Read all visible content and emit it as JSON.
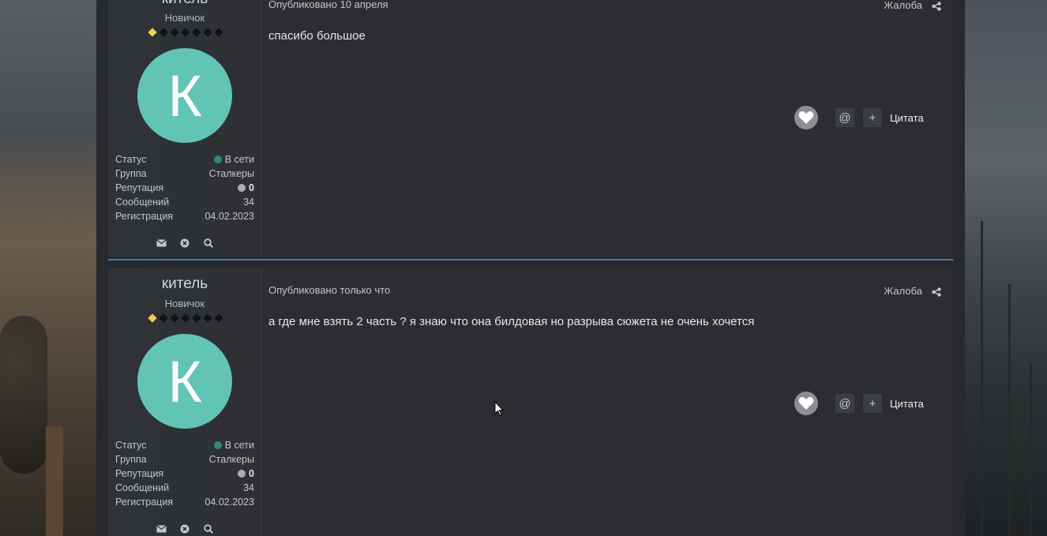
{
  "posts": [
    {
      "author": {
        "name": "китель",
        "rank": "Новичок",
        "avatar_letter": "К",
        "avatar_color": "#62c4b5",
        "rank_pips_filled": 1,
        "rank_pips_total": 7,
        "info": [
          {
            "label": "Статус",
            "value": "В сети"
          },
          {
            "label": "Группа",
            "value": "Сталкеры"
          },
          {
            "label": "Репутация",
            "value": "0"
          },
          {
            "label": "Сообщений",
            "value": "34"
          },
          {
            "label": "Регистрация",
            "value": "04.02.2023"
          }
        ],
        "actions": [
          "envelope-icon",
          "ignore-icon",
          "search-icon"
        ]
      },
      "meta": "Опубликовано 10 апреля",
      "report": "Жалоба",
      "content": "спасибо большое",
      "quote_label": "Цитата",
      "mention_label": "@",
      "multiquote_label": "+"
    },
    {
      "author": {
        "name": "китель",
        "rank": "Новичок",
        "avatar_letter": "К",
        "avatar_color": "#62c4b5",
        "rank_pips_filled": 1,
        "rank_pips_total": 7,
        "info": [
          {
            "label": "Статус",
            "value": "В сети"
          },
          {
            "label": "Группа",
            "value": "Сталкеры"
          },
          {
            "label": "Репутация",
            "value": "0"
          },
          {
            "label": "Сообщений",
            "value": "34"
          },
          {
            "label": "Регистрация",
            "value": "04.02.2023"
          }
        ],
        "actions": [
          "envelope-icon",
          "ignore-icon",
          "search-icon"
        ]
      },
      "meta": "Опубликовано только что",
      "report": "Жалоба",
      "content": "а где мне взять 2 часть ? я знаю что она билдовая но разрыва сюжета не очень хочется",
      "quote_label": "Цитата",
      "mention_label": "@",
      "multiquote_label": "+"
    }
  ],
  "colors": {
    "accent_divider": "#3d7fb3",
    "online": "#2f8f6b",
    "rank_pip": "#f1cd5b"
  }
}
